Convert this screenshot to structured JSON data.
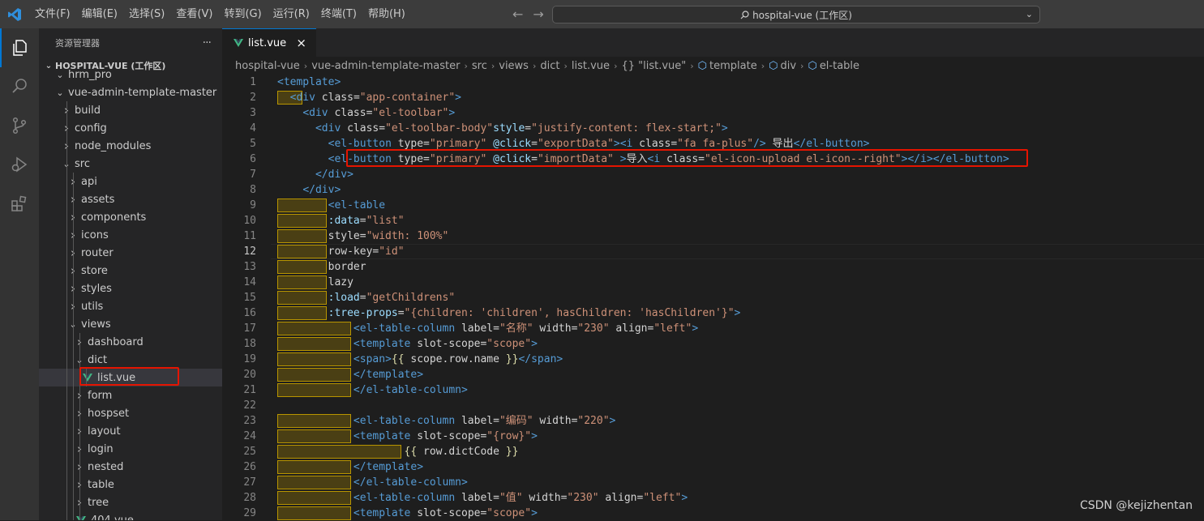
{
  "titlebar": {
    "menu": [
      "文件(F)",
      "编辑(E)",
      "选择(S)",
      "查看(V)",
      "转到(G)",
      "运行(R)",
      "终端(T)",
      "帮助(H)"
    ],
    "search_text": "hospital-vue (工作区)"
  },
  "activitybar": {
    "icons": [
      "explorer-icon",
      "search-icon",
      "source-control-icon",
      "run-debug-icon",
      "extensions-icon"
    ]
  },
  "sidebar": {
    "title": "资源管理器",
    "more": "···",
    "workspace": "HOSPITAL-VUE (工作区)",
    "items": [
      {
        "label": "hrm_pro",
        "expanded": true
      },
      {
        "label": "vue-admin-template-master",
        "expanded": true
      },
      {
        "label": "build",
        "expanded": false
      },
      {
        "label": "config",
        "expanded": false
      },
      {
        "label": "node_modules",
        "expanded": false
      },
      {
        "label": "src",
        "expanded": true
      },
      {
        "label": "api",
        "expanded": false
      },
      {
        "label": "assets",
        "expanded": false
      },
      {
        "label": "components",
        "expanded": false
      },
      {
        "label": "icons",
        "expanded": false
      },
      {
        "label": "router",
        "expanded": false
      },
      {
        "label": "store",
        "expanded": false
      },
      {
        "label": "styles",
        "expanded": false
      },
      {
        "label": "utils",
        "expanded": false
      },
      {
        "label": "views",
        "expanded": true
      },
      {
        "label": "dashboard",
        "expanded": false
      },
      {
        "label": "dict",
        "expanded": true
      },
      {
        "label": "list.vue",
        "file": true,
        "selected": true
      },
      {
        "label": "form",
        "expanded": false
      },
      {
        "label": "hospset",
        "expanded": false
      },
      {
        "label": "layout",
        "expanded": false
      },
      {
        "label": "login",
        "expanded": false
      },
      {
        "label": "nested",
        "expanded": false
      },
      {
        "label": "table",
        "expanded": false
      },
      {
        "label": "tree",
        "expanded": false
      },
      {
        "label": "404.vue",
        "file": true
      }
    ]
  },
  "editor": {
    "tab": {
      "label": "list.vue",
      "close": "×"
    },
    "breadcrumb": [
      "hospital-vue",
      "vue-admin-template-master",
      "src",
      "views",
      "dict",
      "list.vue",
      "{} \"list.vue\"",
      "template",
      "div",
      "el-table"
    ],
    "current_line": 12,
    "lines": [
      {
        "n": 1,
        "text": "<template>"
      },
      {
        "n": 2,
        "text": "  <div class=\"app-container\">"
      },
      {
        "n": 3,
        "text": "    <div class=\"el-toolbar\">"
      },
      {
        "n": 4,
        "text": "      <div class=\"el-toolbar-body\"style=\"justify-content: flex-start;\">"
      },
      {
        "n": 5,
        "text": "        <el-button type=\"primary\" @click=\"exportData\"><i class=\"fa fa-plus\"/> 导出</el-button>"
      },
      {
        "n": 6,
        "text": "        <el-button type=\"primary\" @click=\"importData\" >导入<i class=\"el-icon-upload el-icon--right\"></i></el-button>"
      },
      {
        "n": 7,
        "text": "      </div>"
      },
      {
        "n": 8,
        "text": "    </div>"
      },
      {
        "n": 9,
        "text": "        <el-table"
      },
      {
        "n": 10,
        "text": "        :data=\"list\""
      },
      {
        "n": 11,
        "text": "        style=\"width: 100%\""
      },
      {
        "n": 12,
        "text": "        row-key=\"id\""
      },
      {
        "n": 13,
        "text": "        border"
      },
      {
        "n": 14,
        "text": "        lazy"
      },
      {
        "n": 15,
        "text": "        :load=\"getChildrens\""
      },
      {
        "n": 16,
        "text": "        :tree-props=\"{children: 'children', hasChildren: 'hasChildren'}\">"
      },
      {
        "n": 17,
        "text": "            <el-table-column label=\"名称\" width=\"230\" align=\"left\">"
      },
      {
        "n": 18,
        "text": "            <template slot-scope=\"scope\">"
      },
      {
        "n": 19,
        "text": "            <span>{{ scope.row.name }}</span>"
      },
      {
        "n": 20,
        "text": "            </template>"
      },
      {
        "n": 21,
        "text": "            </el-table-column>"
      },
      {
        "n": 22,
        "text": ""
      },
      {
        "n": 23,
        "text": "            <el-table-column label=\"编码\" width=\"220\">"
      },
      {
        "n": 24,
        "text": "            <template slot-scope=\"{row}\">"
      },
      {
        "n": 25,
        "text": "                    {{ row.dictCode }}"
      },
      {
        "n": 26,
        "text": "            </template>"
      },
      {
        "n": 27,
        "text": "            </el-table-column>"
      },
      {
        "n": 28,
        "text": "            <el-table-column label=\"值\" width=\"230\" align=\"left\">"
      },
      {
        "n": 29,
        "text": "            <template slot-scope=\"scope\">"
      }
    ]
  },
  "watermark": "CSDN @kejizhentan",
  "colors": {
    "accent": "#0078d4",
    "highlight_box": "#e51400",
    "tag": "#569cd6",
    "attr": "#9cdcfe",
    "string": "#ce9178"
  }
}
